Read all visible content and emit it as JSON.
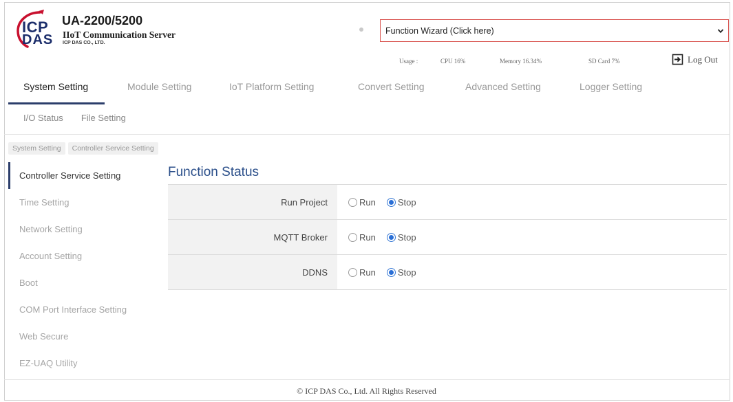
{
  "header": {
    "logo": {
      "line1": "ICP",
      "line2": "DAS"
    },
    "product": "UA-2200/5200",
    "subtitle": "IIoT Communication Server",
    "company": "ICP DAS CO., LTD.",
    "wizard_label": "Function Wizard  (Click here)",
    "usage": {
      "label": "Usage :",
      "cpu": "CPU  16%",
      "memory": "Memory  16.34%",
      "sdcard": "SD Card   7%"
    },
    "logout_label": "Log Out"
  },
  "topnav": {
    "tabs": [
      {
        "label": "System Setting",
        "active": true
      },
      {
        "label": "Module Setting",
        "active": false
      },
      {
        "label": "IoT Platform Setting",
        "active": false
      },
      {
        "label": "Convert Setting",
        "active": false
      },
      {
        "label": "Advanced Setting",
        "active": false
      },
      {
        "label": "Logger Setting",
        "active": false
      }
    ]
  },
  "subnav": {
    "items": [
      "I/O Status",
      "File Setting"
    ]
  },
  "breadcrumb": [
    "System Setting",
    "Controller Service Setting"
  ],
  "sidebar": {
    "items": [
      {
        "label": "Controller Service Setting",
        "active": true
      },
      {
        "label": "Time Setting",
        "active": false
      },
      {
        "label": "Network Setting",
        "active": false
      },
      {
        "label": "Account Setting",
        "active": false
      },
      {
        "label": "Boot",
        "active": false
      },
      {
        "label": "COM Port Interface Setting",
        "active": false
      },
      {
        "label": "Web Secure",
        "active": false
      },
      {
        "label": "EZ-UAQ Utility",
        "active": false
      }
    ]
  },
  "main": {
    "title": "Function Status",
    "run_label": "Run",
    "stop_label": "Stop",
    "rows": [
      {
        "label": "Run Project",
        "value": "Stop"
      },
      {
        "label": "MQTT Broker",
        "value": "Stop"
      },
      {
        "label": "DDNS",
        "value": "Stop"
      }
    ]
  },
  "footer": "© ICP DAS Co., Ltd. All Rights Reserved",
  "colors": {
    "accent": "#2c3e6b",
    "title": "#2b4f8a",
    "wizard_border": "#d9534f",
    "radio_selected": "#2a6fd6"
  }
}
